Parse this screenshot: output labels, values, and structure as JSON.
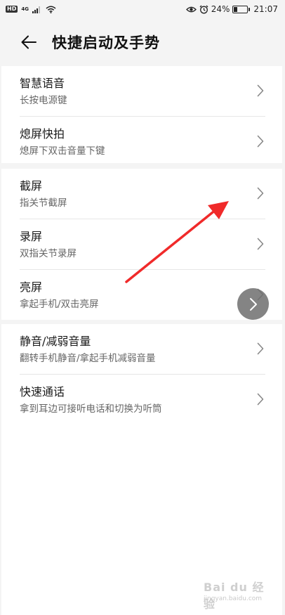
{
  "status_bar": {
    "hd": "HD",
    "network_type": "4G",
    "battery_text": "24%",
    "battery_level": 0.24,
    "time": "21:07"
  },
  "header": {
    "title": "快捷启动及手势",
    "back_icon": "arrow-left-icon"
  },
  "groups": [
    {
      "items": [
        {
          "title": "智慧语音",
          "subtitle": "长按电源键"
        },
        {
          "title": "熄屏快拍",
          "subtitle": "熄屏下双击音量下键"
        }
      ]
    },
    {
      "items": [
        {
          "title": "截屏",
          "subtitle": "指关节截屏"
        },
        {
          "title": "录屏",
          "subtitle": "双指关节录屏"
        },
        {
          "title": "亮屏",
          "subtitle": "拿起手机/双击亮屏"
        }
      ]
    },
    {
      "items": [
        {
          "title": "静音/减弱音量",
          "subtitle": "翻转手机静音/拿起手机减弱音量"
        },
        {
          "title": "快速通话",
          "subtitle": "拿到耳边可接听电话和切换为听筒"
        }
      ]
    }
  ],
  "annotation": {
    "color": "#f02a2a"
  },
  "colors": {
    "background": "#f4f4f4",
    "card": "#ffffff",
    "chevron": "#888888"
  },
  "watermark": {
    "brand": "Bai du 经验",
    "url": "jingyan.baidu.com"
  }
}
